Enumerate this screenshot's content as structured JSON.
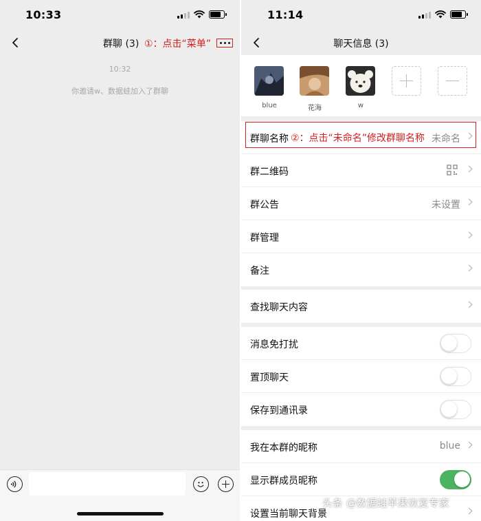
{
  "left": {
    "status": {
      "time": "10:33"
    },
    "nav": {
      "title": "群聊 (3)",
      "annotation": "①：点击“菜单”"
    },
    "chat": {
      "time": "10:32",
      "system_message": "你邀请w、数据蛙加入了群聊"
    }
  },
  "right": {
    "status": {
      "time": "11:14"
    },
    "nav": {
      "title": "聊天信息 (3)"
    },
    "members": [
      {
        "name": "blue"
      },
      {
        "name": "花海"
      },
      {
        "name": "w"
      }
    ],
    "annotation": "②：点击“未命名”修改群聊名称",
    "groups": {
      "info": {
        "group_name_label": "群聊名称",
        "group_name_value": "未命名",
        "qrcode_label": "群二维码",
        "notice_label": "群公告",
        "notice_value": "未设置",
        "manage_label": "群管理",
        "remark_label": "备注"
      },
      "search": {
        "label": "查找聊天内容"
      },
      "toggles": {
        "mute_label": "消息免打扰",
        "mute_on": false,
        "pin_label": "置顶聊天",
        "pin_on": false,
        "save_label": "保存到通讯录",
        "save_on": false
      },
      "nickname": {
        "my_nickname_label": "我在本群的昵称",
        "my_nickname_value": "blue",
        "show_nicknames_label": "显示群成员昵称",
        "show_nicknames_on": true,
        "background_label": "设置当前聊天背景"
      }
    }
  },
  "watermark": "头条 @数据蛙苹果恢复专家",
  "colors": {
    "annotation": "#d0201f",
    "toggle_on": "#4cb460",
    "background": "#ededed"
  }
}
